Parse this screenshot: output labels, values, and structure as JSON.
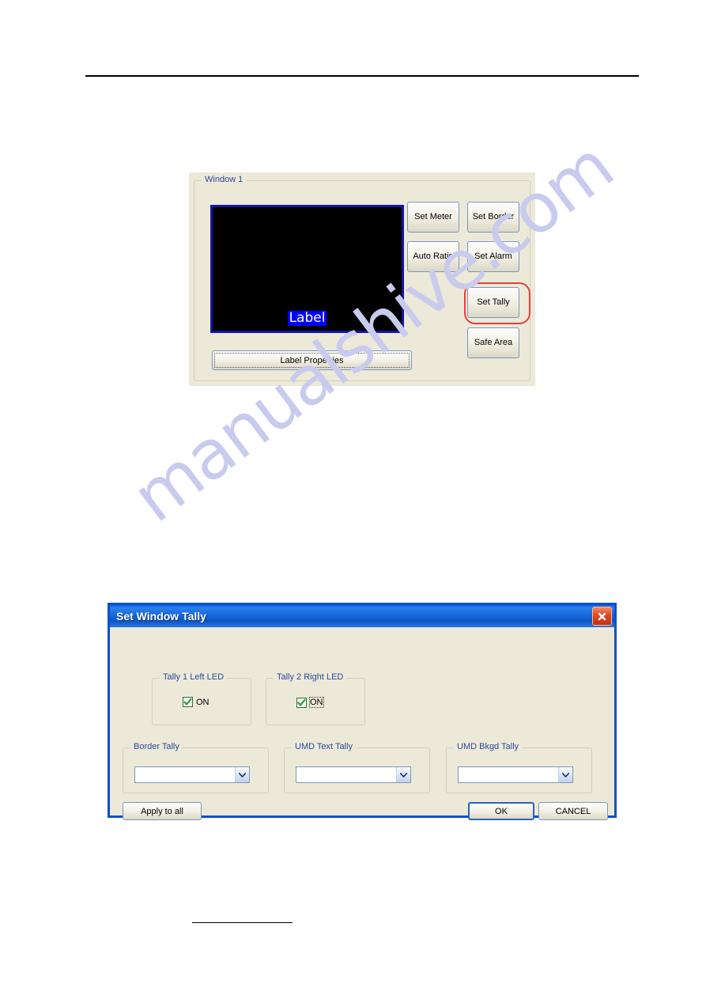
{
  "document": {
    "watermark": "manualshive.com"
  },
  "window_panel": {
    "group_legend": "Window 1",
    "preview": {
      "label_text": "Label",
      "background_color": "#000000",
      "border_color": "#1414aa",
      "label_highlight_color": "#0000ff"
    },
    "label_properties_button": "Label Properties",
    "buttons": [
      {
        "label": "Set Meter",
        "column": "left",
        "row": 1
      },
      {
        "label": "Set Border",
        "column": "right",
        "row": 1
      },
      {
        "label": "Auto Ratio",
        "column": "left",
        "row": 2
      },
      {
        "label": "Set Alarm",
        "column": "right",
        "row": 2
      },
      {
        "label": "Set Tally",
        "column": "right",
        "row": 3
      },
      {
        "label": "Safe Area",
        "column": "right",
        "row": 4
      }
    ],
    "highlight": {
      "target": "Set Tally",
      "color": "#e8403a"
    }
  },
  "dialog": {
    "title": "Set Window Tally",
    "close_icon": "close-icon",
    "titlebar_color": "#1669dc",
    "led_groups": [
      {
        "legend": "Tally 1 Left LED",
        "checkbox_label": "ON",
        "checked": true,
        "focused": false
      },
      {
        "legend": "Tally 2 Right LED",
        "checkbox_label": "ON",
        "checked": true,
        "focused": true
      }
    ],
    "combo_groups": [
      {
        "legend": "Border Tally",
        "value": ""
      },
      {
        "legend": "UMD Text Tally",
        "value": ""
      },
      {
        "legend": "UMD Bkgd Tally",
        "value": ""
      }
    ],
    "buttons": {
      "apply_to_all": "Apply to all",
      "ok": "OK",
      "cancel": "CANCEL"
    }
  }
}
